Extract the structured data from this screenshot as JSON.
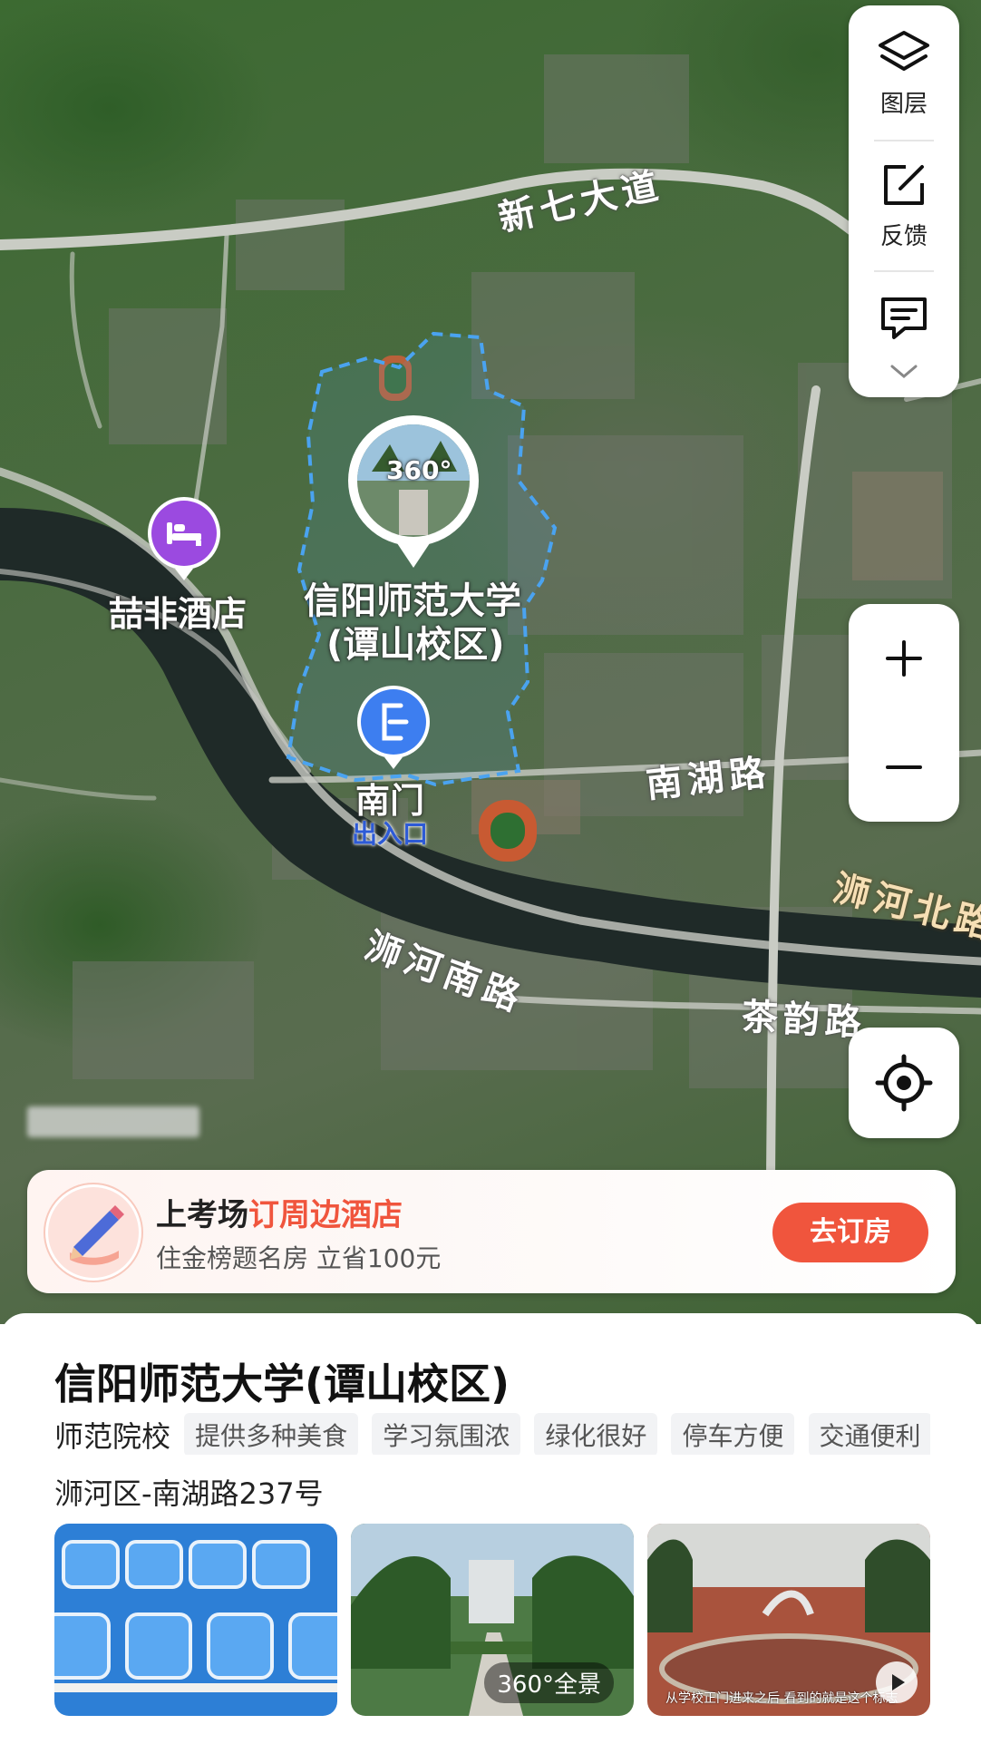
{
  "map": {
    "roads": {
      "xinqi": "新七大道",
      "nanhu": "南湖路",
      "shihe_bei": "浉河北路",
      "shihe_nan": "浉河南路",
      "chayun": "茶韵路"
    },
    "pois": {
      "hotel": "喆非酒店",
      "university_line1": "信阳师范大学",
      "university_line2": "(谭山校区)",
      "gate_name": "南门",
      "gate_sub": "出入口",
      "pano_badge": "360°"
    },
    "colors": {
      "boundary": "#4aa3f0",
      "hotel_pin": "#9b4ae0",
      "gate_pin": "#3d7ef0",
      "river": "#1f2a28"
    }
  },
  "controls": {
    "layers_label": "图层",
    "feedback_label": "反馈",
    "icons": [
      "layers-icon",
      "feedback-edit-icon",
      "message-icon",
      "chevron-down-icon",
      "zoom-in-icon",
      "zoom-out-icon",
      "locate-icon"
    ]
  },
  "promo": {
    "title_prefix": "上考场",
    "title_highlight": "订周边酒店",
    "subtitle": "住金榜题名房 立省100元",
    "button": "去订房",
    "accent": "#f0553d"
  },
  "place": {
    "title": "信阳师范大学(谭山校区)",
    "category": "师范院校",
    "tags": [
      "提供多种美食",
      "学习氛围浓",
      "绿化很好",
      "停车方便",
      "交通便利"
    ],
    "address": "浉河区-南湖路237号",
    "photos": {
      "pano_label": "360°全景",
      "video_caption": "从学校正门进来之后 看到的就是这个标志"
    }
  }
}
